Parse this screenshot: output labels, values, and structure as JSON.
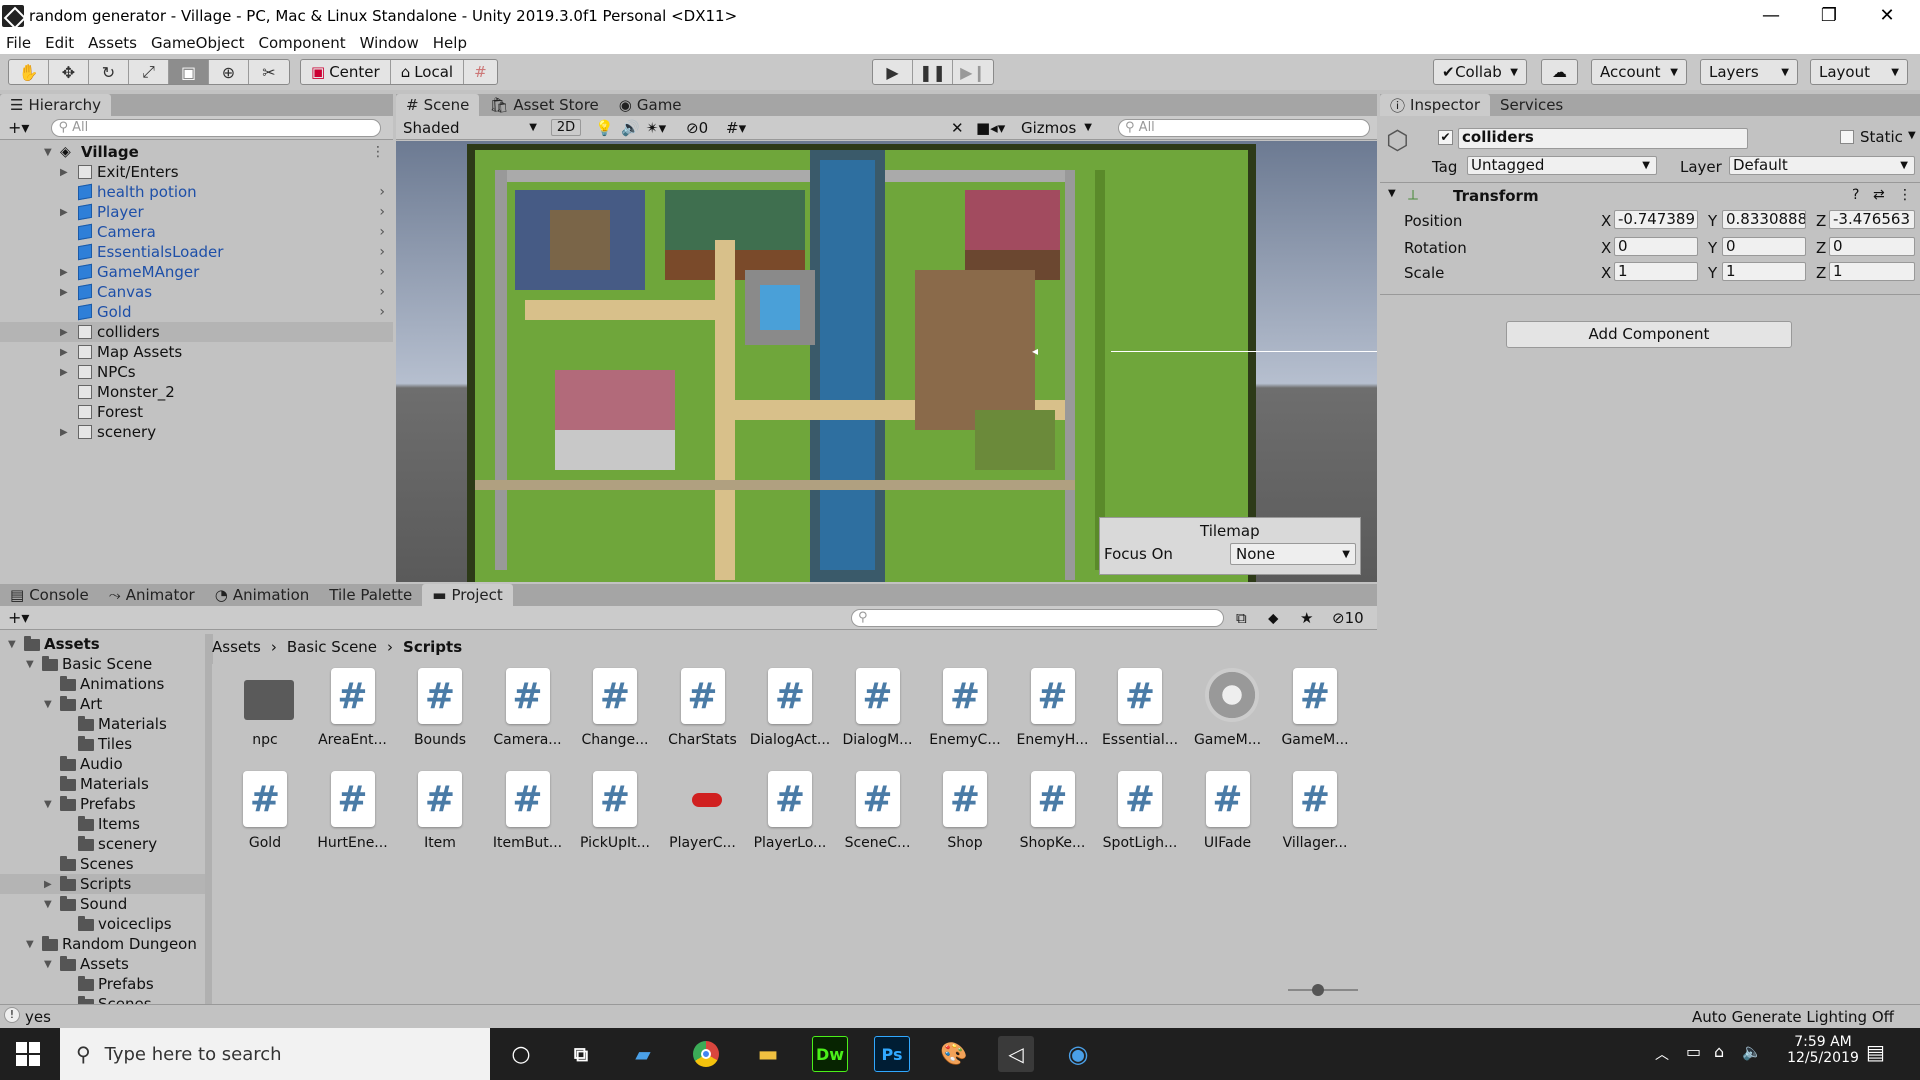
{
  "window": {
    "title": "random generator - Village - PC, Mac & Linux Standalone - Unity 2019.3.0f1 Personal <DX11>",
    "minimize": "—",
    "restore": "❐",
    "close": "✕"
  },
  "menu": [
    "File",
    "Edit",
    "Assets",
    "GameObject",
    "Component",
    "Window",
    "Help"
  ],
  "toolbar": {
    "tools": [
      "hand-icon",
      "move-icon",
      "rotate-icon",
      "scale-icon",
      "rect-icon",
      "transform-icon",
      "custom-tool-icon"
    ],
    "pivot_label": "Center",
    "space_label": "Local",
    "collab_label": "Collab",
    "account_label": "Account",
    "layers_label": "Layers",
    "layout_label": "Layout"
  },
  "hierarchy": {
    "tab": "Hierarchy",
    "search_placeholder": "All",
    "scene": "Village",
    "items": [
      {
        "label": "Exit/Enters",
        "prefab": false,
        "expandable": true,
        "more": false
      },
      {
        "label": "health potion",
        "prefab": true,
        "expandable": false,
        "more": true
      },
      {
        "label": "Player",
        "prefab": true,
        "expandable": true,
        "more": true
      },
      {
        "label": "Camera",
        "prefab": true,
        "expandable": false,
        "more": true
      },
      {
        "label": "EssentialsLoader",
        "prefab": true,
        "expandable": false,
        "more": true
      },
      {
        "label": "GameMAnger",
        "prefab": true,
        "expandable": true,
        "more": true
      },
      {
        "label": "Canvas",
        "prefab": true,
        "expandable": true,
        "more": true
      },
      {
        "label": "Gold",
        "prefab": true,
        "expandable": false,
        "more": true
      },
      {
        "label": "colliders",
        "prefab": false,
        "expandable": true,
        "more": false
      },
      {
        "label": "Map Assets",
        "prefab": false,
        "expandable": true,
        "more": false
      },
      {
        "label": "NPCs",
        "prefab": false,
        "expandable": true,
        "more": false
      },
      {
        "label": "Monster_2",
        "prefab": false,
        "expandable": false,
        "more": false
      },
      {
        "label": "Forest",
        "prefab": false,
        "expandable": false,
        "more": false
      },
      {
        "label": "scenery",
        "prefab": false,
        "expandable": true,
        "more": false
      }
    ]
  },
  "scene": {
    "tabs": [
      "Scene",
      "Asset Store",
      "Game"
    ],
    "shading": "Shaded",
    "mode_2d": "2D",
    "hidden_count": "0",
    "gizmos": "Gizmos",
    "search_placeholder": "All",
    "tilemap_title": "Tilemap",
    "focus_label": "Focus On",
    "focus_value": "None"
  },
  "inspector": {
    "tabs": [
      "Inspector",
      "Services"
    ],
    "object_name": "colliders",
    "static_label": "Static",
    "tag_label": "Tag",
    "tag_value": "Untagged",
    "layer_label": "Layer",
    "layer_value": "Default",
    "component": "Transform",
    "position_label": "Position",
    "rotation_label": "Rotation",
    "scale_label": "Scale",
    "position": {
      "x": "-0.747389",
      "y": "0.8330888",
      "z": "-3.476563"
    },
    "rotation": {
      "x": "0",
      "y": "0",
      "z": "0"
    },
    "scale": {
      "x": "1",
      "y": "1",
      "z": "1"
    },
    "add_component": "Add Component"
  },
  "bottom_tabs": [
    "Console",
    "Animator",
    "Animation",
    "Tile Palette",
    "Project"
  ],
  "project": {
    "hidden_count": "10",
    "breadcrumb": [
      "Assets",
      "Basic Scene",
      "Scripts"
    ],
    "tree": [
      {
        "label": "Assets",
        "level": 0,
        "state": "open",
        "bold": true
      },
      {
        "label": "Basic Scene",
        "level": 1,
        "state": "open"
      },
      {
        "label": "Animations",
        "level": 2,
        "state": "none"
      },
      {
        "label": "Art",
        "level": 2,
        "state": "open"
      },
      {
        "label": "Materials",
        "level": 3,
        "state": "none"
      },
      {
        "label": "Tiles",
        "level": 3,
        "state": "none"
      },
      {
        "label": "Audio",
        "level": 2,
        "state": "none"
      },
      {
        "label": "Materials",
        "level": 2,
        "state": "none"
      },
      {
        "label": "Prefabs",
        "level": 2,
        "state": "open"
      },
      {
        "label": "Items",
        "level": 3,
        "state": "none"
      },
      {
        "label": "scenery",
        "level": 3,
        "state": "none"
      },
      {
        "label": "Scenes",
        "level": 2,
        "state": "none"
      },
      {
        "label": "Scripts",
        "level": 2,
        "state": "closed",
        "selected": true
      },
      {
        "label": "Sound",
        "level": 2,
        "state": "open"
      },
      {
        "label": "voiceclips",
        "level": 3,
        "state": "none"
      },
      {
        "label": "Random Dungeon",
        "level": 1,
        "state": "open"
      },
      {
        "label": "Assets",
        "level": 2,
        "state": "open"
      },
      {
        "label": "Prefabs",
        "level": 3,
        "state": "none"
      },
      {
        "label": "Scenes",
        "level": 3,
        "state": "none"
      }
    ],
    "assets": [
      {
        "name": "npc",
        "kind": "folder"
      },
      {
        "name": "AreaEnt...",
        "kind": "script"
      },
      {
        "name": "Bounds",
        "kind": "script"
      },
      {
        "name": "Camera...",
        "kind": "script"
      },
      {
        "name": "Change...",
        "kind": "script"
      },
      {
        "name": "CharStats",
        "kind": "script"
      },
      {
        "name": "DialogAct...",
        "kind": "script"
      },
      {
        "name": "DialogM...",
        "kind": "script"
      },
      {
        "name": "EnemyC...",
        "kind": "script"
      },
      {
        "name": "EnemyH...",
        "kind": "script"
      },
      {
        "name": "Essential...",
        "kind": "script"
      },
      {
        "name": "GameM...",
        "kind": "gear"
      },
      {
        "name": "GameM...",
        "kind": "script"
      },
      {
        "name": "Gold",
        "kind": "script"
      },
      {
        "name": "HurtEne...",
        "kind": "script"
      },
      {
        "name": "Item",
        "kind": "script"
      },
      {
        "name": "ItemBut...",
        "kind": "script"
      },
      {
        "name": "PickUpIt...",
        "kind": "script"
      },
      {
        "name": "PlayerC...",
        "kind": "pill"
      },
      {
        "name": "PlayerLo...",
        "kind": "script"
      },
      {
        "name": "SceneC...",
        "kind": "script"
      },
      {
        "name": "Shop",
        "kind": "script"
      },
      {
        "name": "ShopKe...",
        "kind": "script"
      },
      {
        "name": "SpotLigh...",
        "kind": "script"
      },
      {
        "name": "UIFade",
        "kind": "script"
      },
      {
        "name": "Villager...",
        "kind": "script"
      }
    ]
  },
  "status": {
    "message": "yes",
    "lighting": "Auto Generate Lighting Off"
  },
  "taskbar": {
    "search_placeholder": "Type here to search",
    "time": "7:59 AM",
    "date": "12/5/2019",
    "apps": [
      "cortana-icon",
      "task-view-icon",
      "explorer-alt-icon",
      "chrome-icon",
      "file-explorer-icon",
      "dreamweaver-icon",
      "photoshop-icon",
      "paint-icon",
      "unity-icon",
      "recorder-icon"
    ]
  }
}
